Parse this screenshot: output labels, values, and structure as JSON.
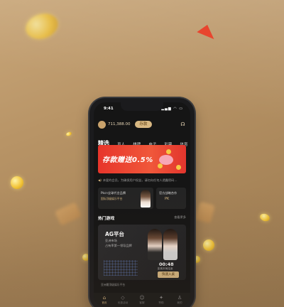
{
  "status": {
    "time": "9:41",
    "icons": "▂▄▆ ◠ ▭"
  },
  "account": {
    "balance": "711,388.00",
    "deposit_label": "存款",
    "support_icon": "headset-icon"
  },
  "tabs": [
    {
      "label": "精选",
      "active": true
    },
    {
      "label": "真人"
    },
    {
      "label": "棋牌"
    },
    {
      "label": "电子"
    },
    {
      "label": "彩票"
    },
    {
      "label": "体育"
    }
  ],
  "banner": {
    "text": "存款赠送0.5%"
  },
  "notice": {
    "icon": "speaker-icon",
    "text": "亲爱的会员，为确保用户权益，请勿向任何人透露密码…"
  },
  "cards": {
    "left": {
      "title": "Pkcn全球代言品牌",
      "subtitle": "国际顶级娱乐平台"
    },
    "right": {
      "title": "官方战略合作",
      "logo": "PK"
    }
  },
  "section": {
    "title": "热门游戏",
    "more": "查看更多"
  },
  "game": {
    "title": "AG平台",
    "sub1": "亚洲市场",
    "sub2": "占有率第一领导品牌",
    "timer": "00:48",
    "timer_label": "距离本局结束",
    "enter_label": "快速入桌"
  },
  "bottom_text": "亚洲最顶级娱乐平台",
  "nav": [
    {
      "label": "首页",
      "icon": "home-icon",
      "glyph": "⌂",
      "active": true
    },
    {
      "label": "优惠活动",
      "icon": "gift-icon",
      "glyph": "◇"
    },
    {
      "label": "客服",
      "icon": "chat-icon",
      "glyph": "☺"
    },
    {
      "label": "赞助",
      "icon": "star-icon",
      "glyph": "✦"
    },
    {
      "label": "我的",
      "icon": "user-icon",
      "glyph": "♙"
    }
  ],
  "colors": {
    "accent": "#d8b882",
    "banner": "#e7352b",
    "screen": "#151515"
  }
}
